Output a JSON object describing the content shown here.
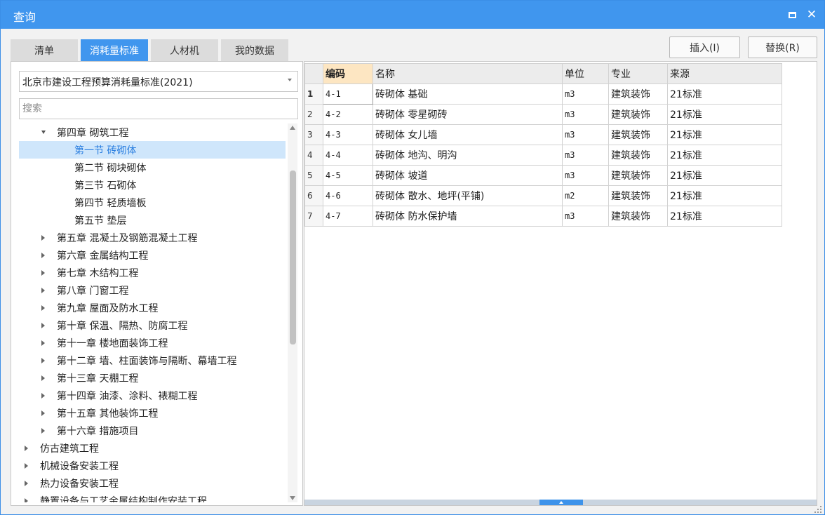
{
  "window": {
    "title": "查询",
    "maximize_icon": "maximize-icon",
    "close_glyph": "✕",
    "accent_color": "#4096ee"
  },
  "tabs": [
    {
      "label": "清单",
      "active": false
    },
    {
      "label": "消耗量标准",
      "active": true
    },
    {
      "label": "人材机",
      "active": false
    },
    {
      "label": "我的数据",
      "active": false
    }
  ],
  "actions": {
    "insert_label": "插入(I)",
    "replace_label": "替换(R)"
  },
  "left": {
    "standard_selected": "北京市建设工程预算消耗量标准(2021)",
    "search_placeholder": "搜索",
    "tree": [
      {
        "label": "第四章 砌筑工程",
        "level": 1,
        "state": "expanded",
        "selected": false
      },
      {
        "label": "第一节 砖砌体",
        "level": 2,
        "state": "leaf",
        "selected": true
      },
      {
        "label": "第二节 砌块砌体",
        "level": 2,
        "state": "leaf",
        "selected": false
      },
      {
        "label": "第三节 石砌体",
        "level": 2,
        "state": "leaf",
        "selected": false
      },
      {
        "label": "第四节 轻质墙板",
        "level": 2,
        "state": "leaf",
        "selected": false
      },
      {
        "label": "第五节 垫层",
        "level": 2,
        "state": "leaf",
        "selected": false
      },
      {
        "label": "第五章 混凝土及钢筋混凝土工程",
        "level": 1,
        "state": "collapsed",
        "selected": false
      },
      {
        "label": "第六章 金属结构工程",
        "level": 1,
        "state": "collapsed",
        "selected": false
      },
      {
        "label": "第七章 木结构工程",
        "level": 1,
        "state": "collapsed",
        "selected": false
      },
      {
        "label": "第八章 门窗工程",
        "level": 1,
        "state": "collapsed",
        "selected": false
      },
      {
        "label": "第九章 屋面及防水工程",
        "level": 1,
        "state": "collapsed",
        "selected": false
      },
      {
        "label": "第十章 保温、隔热、防腐工程",
        "level": 1,
        "state": "collapsed",
        "selected": false
      },
      {
        "label": "第十一章 楼地面装饰工程",
        "level": 1,
        "state": "collapsed",
        "selected": false
      },
      {
        "label": "第十二章 墙、柱面装饰与隔断、幕墙工程",
        "level": 1,
        "state": "collapsed",
        "selected": false
      },
      {
        "label": "第十三章 天棚工程",
        "level": 1,
        "state": "collapsed",
        "selected": false
      },
      {
        "label": "第十四章 油漆、涂料、裱糊工程",
        "level": 1,
        "state": "collapsed",
        "selected": false
      },
      {
        "label": "第十五章 其他装饰工程",
        "level": 1,
        "state": "collapsed",
        "selected": false
      },
      {
        "label": "第十六章 措施项目",
        "level": 1,
        "state": "collapsed",
        "selected": false
      },
      {
        "label": "仿古建筑工程",
        "level": 0,
        "state": "collapsed",
        "selected": false
      },
      {
        "label": "机械设备安装工程",
        "level": 0,
        "state": "collapsed",
        "selected": false
      },
      {
        "label": "热力设备安装工程",
        "level": 0,
        "state": "collapsed",
        "selected": false
      },
      {
        "label": "静置设备与工艺金属结构制作安装工程",
        "level": 0,
        "state": "collapsed",
        "selected": false
      }
    ]
  },
  "grid": {
    "columns": [
      {
        "key": "code",
        "label": "编码",
        "sorted": true
      },
      {
        "key": "name",
        "label": "名称",
        "sorted": false
      },
      {
        "key": "unit",
        "label": "单位",
        "sorted": false
      },
      {
        "key": "major",
        "label": "专业",
        "sorted": false
      },
      {
        "key": "source",
        "label": "来源",
        "sorted": false
      }
    ],
    "rows": [
      {
        "no": "1",
        "code": "4-1",
        "name": "砖砌体 基础",
        "unit": "m3",
        "major": "建筑装饰",
        "source": "21标准",
        "current": true
      },
      {
        "no": "2",
        "code": "4-2",
        "name": "砖砌体 零星砌砖",
        "unit": "m3",
        "major": "建筑装饰",
        "source": "21标准",
        "current": false
      },
      {
        "no": "3",
        "code": "4-3",
        "name": "砖砌体 女儿墙",
        "unit": "m3",
        "major": "建筑装饰",
        "source": "21标准",
        "current": false
      },
      {
        "no": "4",
        "code": "4-4",
        "name": "砖砌体 地沟、明沟",
        "unit": "m3",
        "major": "建筑装饰",
        "source": "21标准",
        "current": false
      },
      {
        "no": "5",
        "code": "4-5",
        "name": "砖砌体 坡道",
        "unit": "m3",
        "major": "建筑装饰",
        "source": "21标准",
        "current": false
      },
      {
        "no": "6",
        "code": "4-6",
        "name": "砖砌体 散水、地坪(平铺)",
        "unit": "m2",
        "major": "建筑装饰",
        "source": "21标准",
        "current": false
      },
      {
        "no": "7",
        "code": "4-7",
        "name": "砖砌体 防水保护墙",
        "unit": "m3",
        "major": "建筑装饰",
        "source": "21标准",
        "current": false
      }
    ]
  }
}
